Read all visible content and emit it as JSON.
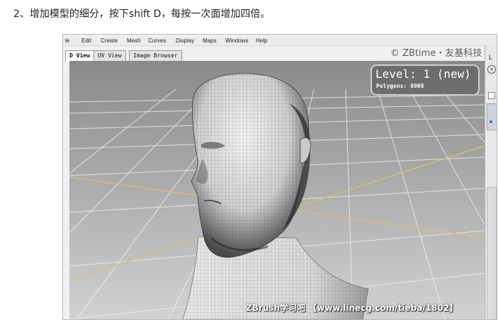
{
  "caption": "2、增加模型的细分，按下shift D，每按一次面增加四倍。",
  "app": {
    "menu": [
      "le",
      "Edit",
      "Create",
      "Mesh",
      "Curves",
      "Display",
      "Maps",
      "Windows",
      "Help"
    ],
    "tabs": [
      "D View",
      "UV View",
      "Image Browser"
    ],
    "active_tab": "D View",
    "watermark_top": "© ZBtime・友基科技",
    "watermark_bottom": "ZBrush学习吧 【www.linecg.com/tieba/1802】",
    "hud": {
      "level": "Level: 1 (new)",
      "polygons": "Polygons: 8008"
    },
    "side_panel": {
      "letter": "L",
      "close_glyph": "×"
    }
  },
  "icons": [
    "close-icon",
    "checkbox-icon"
  ],
  "colors": {
    "grid_bg_top": "#8c8c8c",
    "grid_bg_bottom": "#cfcfcf",
    "axis_line": "#d6c172",
    "hud_bg": "#5f5f64",
    "model_light": "#f2f2f2",
    "model_shadow": "#2a2a2a"
  }
}
